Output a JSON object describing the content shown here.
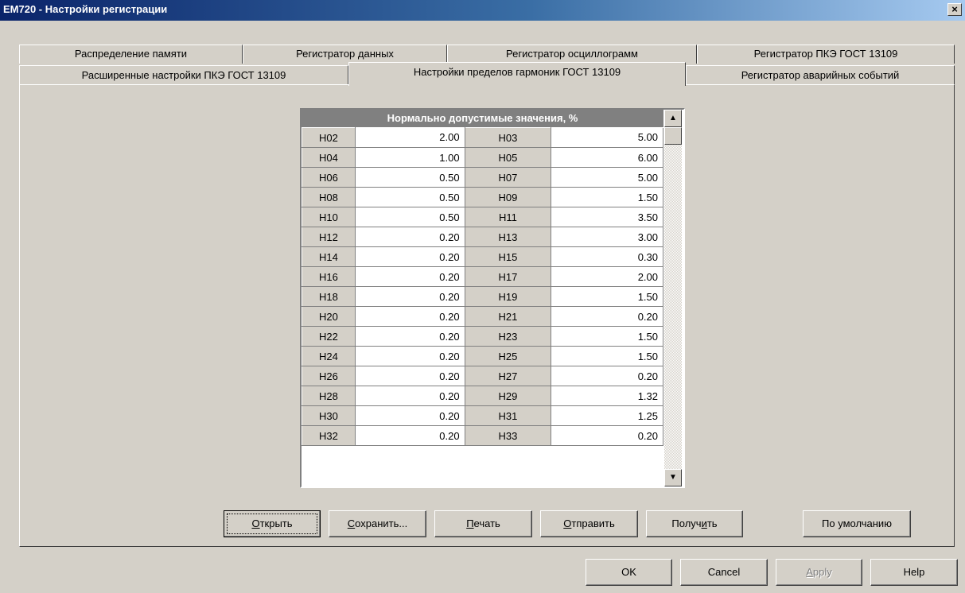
{
  "window": {
    "title": "EM720 - Настройки регистрации",
    "close_symbol": "×"
  },
  "tabs_row1": [
    {
      "label": "Распределение памяти"
    },
    {
      "label": "Регистратор данных"
    },
    {
      "label": "Регистратор осциллограмм"
    },
    {
      "label": "Регистратор ПКЭ ГОСТ 13109"
    }
  ],
  "tabs_row2": [
    {
      "label": "Расширенные настройки ПКЭ ГОСТ 13109"
    },
    {
      "label": "Настройки пределов гармоник ГОСТ 13109",
      "active": true
    },
    {
      "label": "Регистратор аварийных событий"
    }
  ],
  "grid": {
    "header": "Нормально допустимые значения, %",
    "rows": [
      [
        "H02",
        "2.00",
        "H03",
        "5.00"
      ],
      [
        "H04",
        "1.00",
        "H05",
        "6.00"
      ],
      [
        "H06",
        "0.50",
        "H07",
        "5.00"
      ],
      [
        "H08",
        "0.50",
        "H09",
        "1.50"
      ],
      [
        "H10",
        "0.50",
        "H11",
        "3.50"
      ],
      [
        "H12",
        "0.20",
        "H13",
        "3.00"
      ],
      [
        "H14",
        "0.20",
        "H15",
        "0.30"
      ],
      [
        "H16",
        "0.20",
        "H17",
        "2.00"
      ],
      [
        "H18",
        "0.20",
        "H19",
        "1.50"
      ],
      [
        "H20",
        "0.20",
        "H21",
        "0.20"
      ],
      [
        "H22",
        "0.20",
        "H23",
        "1.50"
      ],
      [
        "H24",
        "0.20",
        "H25",
        "1.50"
      ],
      [
        "H26",
        "0.20",
        "H27",
        "0.20"
      ],
      [
        "H28",
        "0.20",
        "H29",
        "1.32"
      ],
      [
        "H30",
        "0.20",
        "H31",
        "1.25"
      ],
      [
        "H32",
        "0.20",
        "H33",
        "0.20"
      ]
    ]
  },
  "actions": {
    "open": {
      "pre": "",
      "u": "О",
      "post": "ткрыть"
    },
    "save": {
      "pre": "",
      "u": "С",
      "post": "охранить..."
    },
    "print": {
      "pre": "",
      "u": "П",
      "post": "ечать"
    },
    "send": {
      "pre": "",
      "u": "О",
      "post": "тправить"
    },
    "receive": {
      "pre": "Получ",
      "u": "и",
      "post": "ть"
    },
    "defaults": "По умолчанию"
  },
  "dialog": {
    "ok": "OK",
    "cancel": "Cancel",
    "apply": {
      "pre": "",
      "u": "A",
      "post": "pply"
    },
    "help": "Help"
  }
}
